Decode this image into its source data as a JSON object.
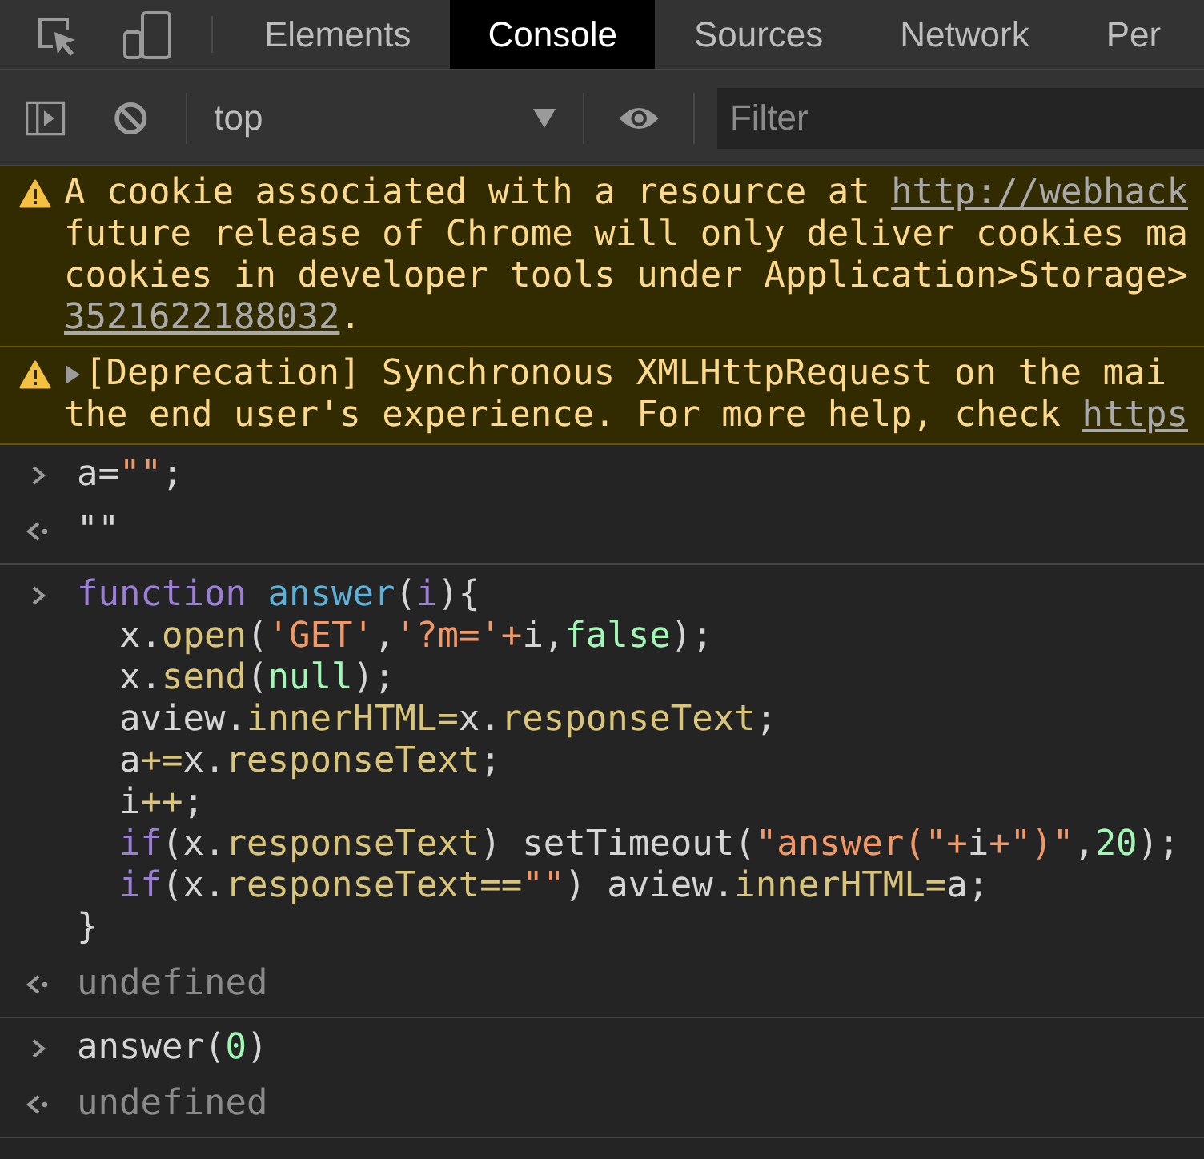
{
  "tabs": [
    {
      "label": "Elements",
      "selected": false
    },
    {
      "label": "Console",
      "selected": true
    },
    {
      "label": "Sources",
      "selected": false
    },
    {
      "label": "Network",
      "selected": false
    },
    {
      "label": "Per",
      "selected": false
    }
  ],
  "toolbar": {
    "context": "top",
    "filter_placeholder": "Filter"
  },
  "messages": [
    {
      "kind": "warning",
      "expandable": false,
      "lines": [
        [
          {
            "text": "A cookie associated with a resource at ",
            "link": false
          },
          {
            "text": "http://webhack",
            "link": true
          }
        ],
        [
          {
            "text": "future release of Chrome will only deliver cookies ma",
            "link": false
          }
        ],
        [
          {
            "text": "cookies in developer tools under Application>Storage>",
            "link": false
          }
        ],
        [
          {
            "text": "3521622188032",
            "link": true
          },
          {
            "text": ".",
            "link": false
          }
        ]
      ]
    },
    {
      "kind": "warning",
      "expandable": true,
      "lines": [
        [
          {
            "text": "[Deprecation] Synchronous XMLHttpRequest on the mai",
            "link": false
          }
        ],
        [
          {
            "text": "the end user's experience. For more help, check ",
            "link": false
          },
          {
            "text": "https",
            "link": true
          }
        ]
      ]
    }
  ],
  "groups": [
    {
      "input": [
        [
          {
            "kind": "plain",
            "text": "a="
          },
          {
            "kind": "string",
            "text": "\"\""
          },
          {
            "kind": "plain",
            "text": ";"
          }
        ]
      ],
      "result": [
        {
          "kind": "plain",
          "text": "\"\""
        }
      ]
    },
    {
      "input": [
        [
          {
            "kind": "keyword",
            "text": "function"
          },
          {
            "kind": "function",
            "text": " answer"
          },
          {
            "kind": "plain",
            "text": "("
          },
          {
            "kind": "keyword",
            "text": "i"
          },
          {
            "kind": "plain",
            "text": "){"
          }
        ],
        [
          {
            "kind": "plain",
            "text": "  x."
          },
          {
            "kind": "property",
            "text": "open"
          },
          {
            "kind": "plain",
            "text": "("
          },
          {
            "kind": "string",
            "text": "'GET'"
          },
          {
            "kind": "plain",
            "text": ","
          },
          {
            "kind": "string",
            "text": "'?m='+"
          },
          {
            "kind": "plain",
            "text": "i,"
          },
          {
            "kind": "literal",
            "text": "false"
          },
          {
            "kind": "plain",
            "text": ");"
          }
        ],
        [
          {
            "kind": "plain",
            "text": "  x."
          },
          {
            "kind": "property",
            "text": "send"
          },
          {
            "kind": "plain",
            "text": "("
          },
          {
            "kind": "literal",
            "text": "null"
          },
          {
            "kind": "plain",
            "text": ");"
          }
        ],
        [
          {
            "kind": "plain",
            "text": "  aview."
          },
          {
            "kind": "property",
            "text": "innerHTML="
          },
          {
            "kind": "plain",
            "text": "x."
          },
          {
            "kind": "property",
            "text": "responseText"
          },
          {
            "kind": "plain",
            "text": ";"
          }
        ],
        [
          {
            "kind": "plain",
            "text": "  a"
          },
          {
            "kind": "property",
            "text": "+="
          },
          {
            "kind": "plain",
            "text": "x."
          },
          {
            "kind": "property",
            "text": "responseText"
          },
          {
            "kind": "plain",
            "text": ";"
          }
        ],
        [
          {
            "kind": "plain",
            "text": "  i"
          },
          {
            "kind": "property",
            "text": "++"
          },
          {
            "kind": "plain",
            "text": ";"
          }
        ],
        [
          {
            "kind": "keyword",
            "text": "  if"
          },
          {
            "kind": "plain",
            "text": "(x."
          },
          {
            "kind": "property",
            "text": "responseText"
          },
          {
            "kind": "plain",
            "text": ") setTimeout("
          },
          {
            "kind": "string",
            "text": "\"answer(\"+"
          },
          {
            "kind": "plain",
            "text": "i"
          },
          {
            "kind": "string",
            "text": "+\")\""
          },
          {
            "kind": "plain",
            "text": ","
          },
          {
            "kind": "literal",
            "text": "20"
          },
          {
            "kind": "plain",
            "text": ");"
          }
        ],
        [
          {
            "kind": "keyword",
            "text": "  if"
          },
          {
            "kind": "plain",
            "text": "(x."
          },
          {
            "kind": "property",
            "text": "responseText=="
          },
          {
            "kind": "string",
            "text": "\"\""
          },
          {
            "kind": "plain",
            "text": ") aview."
          },
          {
            "kind": "property",
            "text": "innerHTML="
          },
          {
            "kind": "plain",
            "text": "a;"
          }
        ],
        [
          {
            "kind": "plain",
            "text": "}"
          }
        ]
      ],
      "result": [
        {
          "kind": "muted",
          "text": "undefined"
        }
      ]
    },
    {
      "input": [
        [
          {
            "kind": "plain",
            "text": "answer("
          },
          {
            "kind": "literal",
            "text": "0"
          },
          {
            "kind": "plain",
            "text": ")"
          }
        ]
      ],
      "result": [
        {
          "kind": "muted",
          "text": "undefined"
        }
      ]
    }
  ]
}
